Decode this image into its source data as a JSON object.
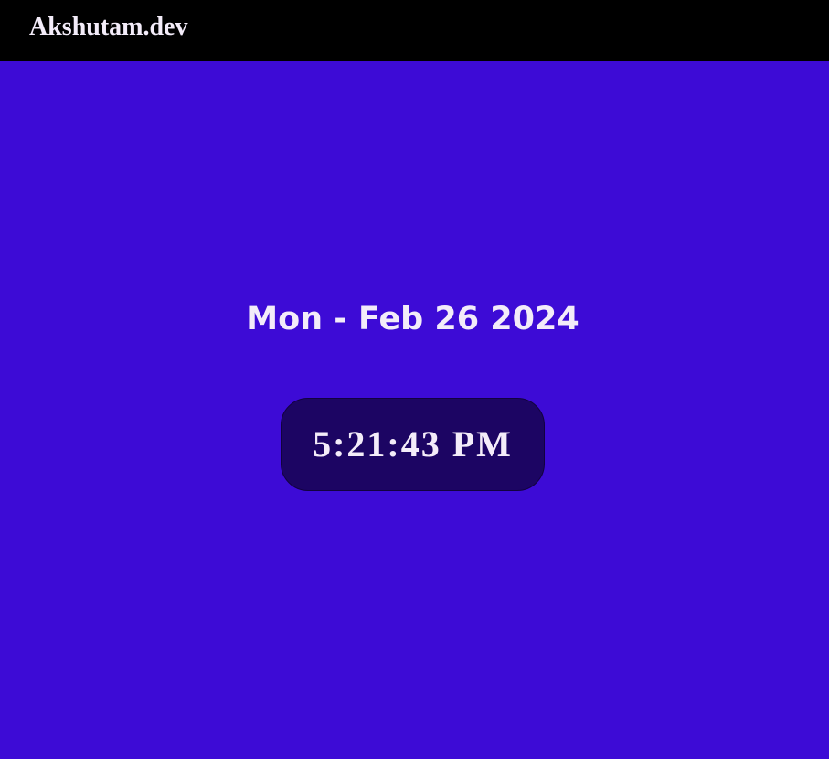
{
  "header": {
    "brand": "Akshutam.dev"
  },
  "main": {
    "date": "Mon - Feb 26 2024",
    "time": "5:21:43",
    "meridiem": "PM"
  },
  "colors": {
    "background": "#3d0bd6",
    "header": "#000000",
    "clock_box": "#1c0563",
    "text": "#f3ecf9"
  }
}
